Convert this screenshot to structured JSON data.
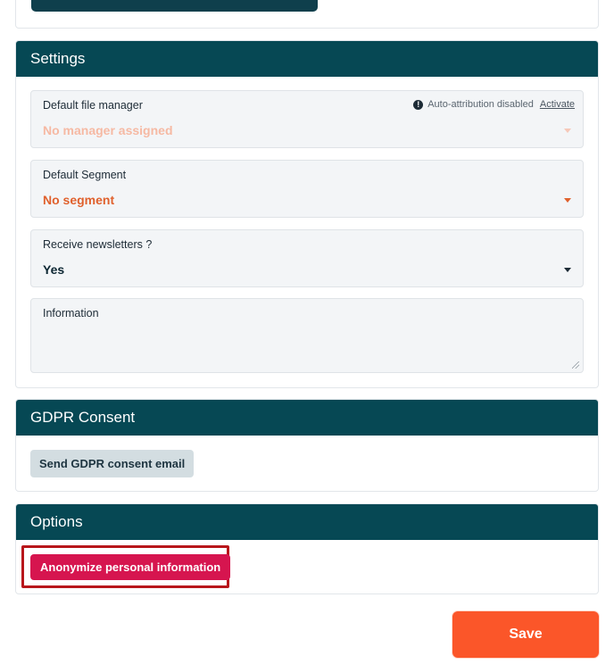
{
  "settings": {
    "title": "Settings",
    "file_manager": {
      "label": "Default file manager",
      "value": "No manager assigned",
      "auto_attribution": "Auto-attribution disabled",
      "activate": "Activate"
    },
    "segment": {
      "label": "Default Segment",
      "value": "No segment"
    },
    "newsletters": {
      "label": "Receive newsletters ?",
      "value": "Yes"
    },
    "information": {
      "label": "Information",
      "value": ""
    }
  },
  "gdpr": {
    "title": "GDPR Consent",
    "send_label": "Send GDPR consent email"
  },
  "options": {
    "title": "Options",
    "anonymize_label": "Anonymize personal information"
  },
  "footer": {
    "save_label": "Save"
  },
  "icons": {
    "info": "info-circle-icon",
    "caret": "caret-down-icon",
    "resize": "resize-handle-icon"
  },
  "colors": {
    "header": "#064854",
    "save": "#fb5629",
    "anonymize": "#d6154f",
    "highlight": "#b8161b",
    "segment_value": "#e0612d"
  }
}
